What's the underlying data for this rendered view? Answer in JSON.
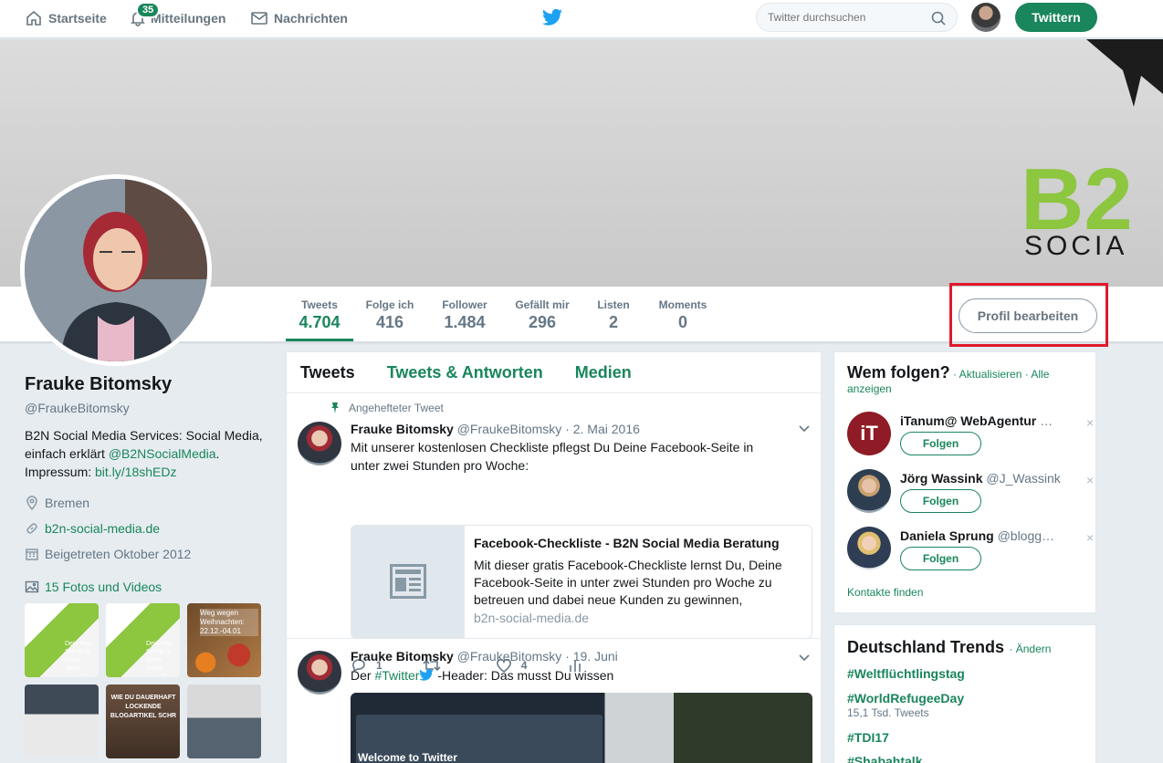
{
  "nav": {
    "home_label": "Startseite",
    "notifications_label": "Mitteilungen",
    "notifications_badge": "35",
    "messages_label": "Nachrichten",
    "search_placeholder": "Twitter durchsuchen",
    "tweet_button": "Twittern"
  },
  "banner": {
    "logo_text_1": "B2",
    "logo_text_2": "SOCIA"
  },
  "stats": [
    {
      "label": "Tweets",
      "value": "4.704"
    },
    {
      "label": "Folge ich",
      "value": "416"
    },
    {
      "label": "Follower",
      "value": "1.484"
    },
    {
      "label": "Gefällt mir",
      "value": "296"
    },
    {
      "label": "Listen",
      "value": "2"
    },
    {
      "label": "Moments",
      "value": "0"
    }
  ],
  "edit_profile_button": "Profil bearbeiten",
  "profile": {
    "name": "Frauke Bitomsky",
    "handle": "@FraukeBitomsky",
    "bio_1": "B2N Social Media Services: Social Media, einfach erklärt ",
    "bio_mention": "@B2NSocialMedia",
    "bio_2": ".",
    "bio_3": "Impressum: ",
    "bio_link": "bit.ly/18shEDz",
    "location": "Bremen",
    "website": "b2n-social-media.de",
    "joined": "Beigetreten Oktober 2012",
    "photos_label": "15 Fotos und Videos",
    "thumb_texts": [
      "Dein eige Schritt fü Ohne Vorke ohne Prog",
      "Dein eige Schritt fü Ohne Vorke ohne Prog",
      "Weg wegen Weihnachten: 22.12.-04.01",
      "",
      "WIE DU DAUERHAFT LOCKENDE BLOGARTIKEL SCHR",
      ""
    ]
  },
  "timeline": {
    "tabs": [
      "Tweets",
      "Tweets & Antworten",
      "Medien"
    ],
    "pinned_label": "Angehefteter Tweet",
    "tweets": [
      {
        "name": "Frauke Bitomsky",
        "handle": "@FraukeBitomsky",
        "date": "· 2. Mai 2016",
        "text": "Mit unserer kostenlosen Checkliste pflegst Du Deine Facebook-Seite in unter zwei Stunden pro Woche:",
        "card": {
          "title": "Facebook-Checkliste - B2N Social Media Beratung",
          "description": "Mit dieser gratis Facebook-Checkliste lernst Du, Deine Facebook-Seite in unter zwei Stunden pro Woche zu betreuen und dabei neue Kunden zu gewinnen,",
          "url": "b2n-social-media.de"
        },
        "replies": "1",
        "retweets": "",
        "likes": "4"
      },
      {
        "name": "Frauke Bitomsky",
        "handle": "@FraukeBitomsky",
        "date": "· 19. Juni",
        "text_1": "Der ",
        "hashtag": "#Twitter",
        "text_2": " -Header: Das musst Du wissen",
        "media_text": "Welcome to Twitter"
      }
    ]
  },
  "who_to_follow": {
    "title": "Wem folgen?",
    "refresh": "· Aktualisieren ·",
    "all": "Alle anzeigen",
    "follow_label": "Folgen",
    "close_glyph": "×",
    "suggestions": [
      {
        "name": "iTanum@ WebAgentur",
        "handle": "…",
        "avatar_text": "iT"
      },
      {
        "name": "Jörg Wassink",
        "handle": "@J_Wassink",
        "avatar_text": ""
      },
      {
        "name": "Daniela Sprung",
        "handle": "@blogg…",
        "avatar_text": ""
      }
    ],
    "find_contacts": "Kontakte finden"
  },
  "trends": {
    "title": "Deutschland Trends",
    "change": "· Ändern",
    "items": [
      {
        "tag": "#Weltflüchtlingstag",
        "sub": ""
      },
      {
        "tag": "#WorldRefugeeDay",
        "sub": "15,1 Tsd. Tweets"
      },
      {
        "tag": "#TDI17",
        "sub": ""
      },
      {
        "tag": "#Shabahtalk",
        "sub": ""
      }
    ]
  },
  "colors": {
    "accent": "#19865b",
    "highlight_box": "#e0192a",
    "twitter_blue": "#1da1f2"
  }
}
